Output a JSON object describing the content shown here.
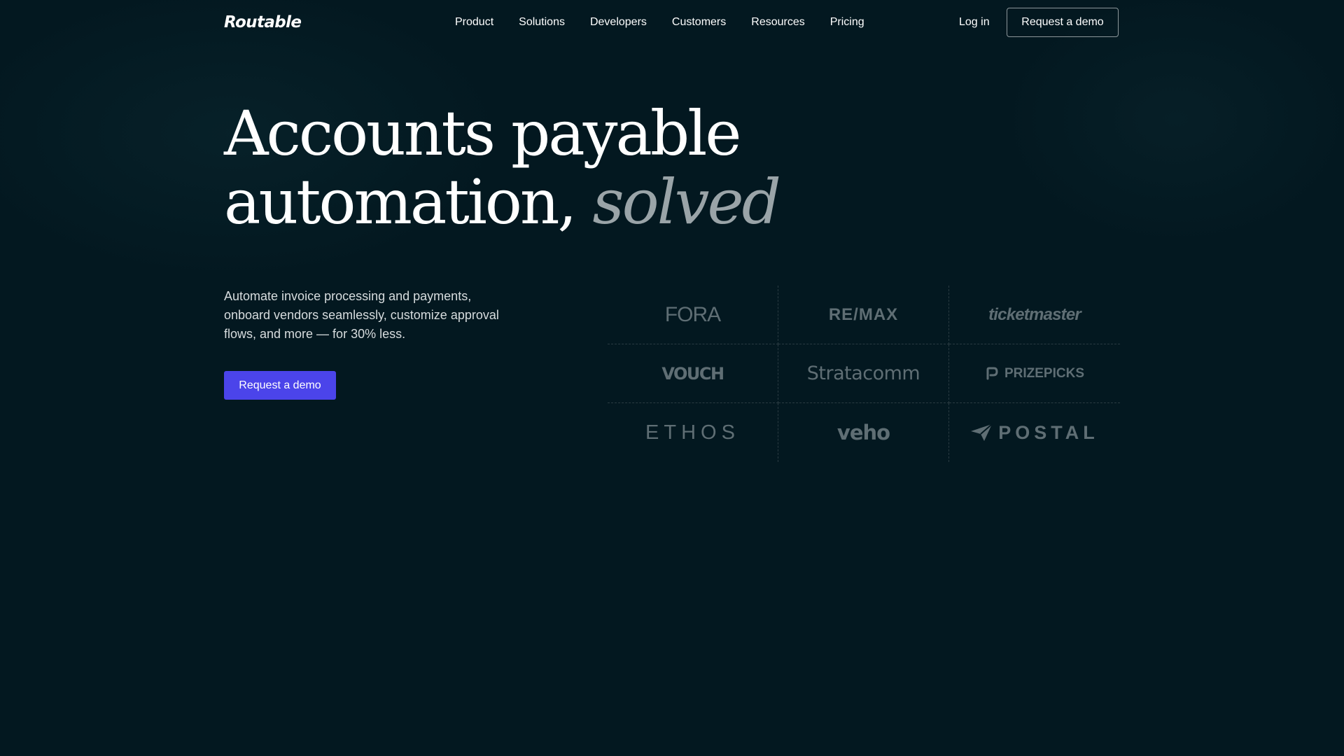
{
  "nav": {
    "logo": "Routable",
    "links": [
      "Product",
      "Solutions",
      "Developers",
      "Customers",
      "Resources",
      "Pricing"
    ],
    "login": "Log in",
    "cta": "Request a demo"
  },
  "hero": {
    "headline_line1": "Accounts payable",
    "headline_line2_start": "automation, ",
    "headline_emphasis": "solved",
    "subtext": "Automate invoice processing and payments, onboard vendors seamlessly, customize approval flows, and more — for 30% less.",
    "cta": "Request a demo"
  },
  "customer_logos": [
    "FORA",
    "RE/MAX",
    "ticketmaster",
    "VOUCH",
    "Stratacomm",
    "PRIZEPICKS",
    "ETHOS",
    "veho",
    "POSTAL"
  ],
  "colors": {
    "background": "#031820",
    "accent": "#4b44ea",
    "emphasis_text": "#9aa4a8",
    "logo_gray": "#5f6e74"
  }
}
